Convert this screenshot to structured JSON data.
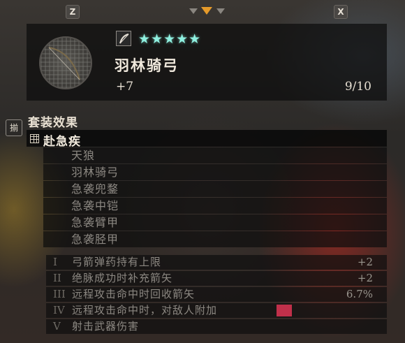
{
  "hotkeys": {
    "left": "Z",
    "right": "X"
  },
  "item": {
    "stars": "★★★★★",
    "name": "羽林骑弓",
    "enhance": "+7",
    "durability": "9/10",
    "icon": "bow-icon"
  },
  "side_tab": {
    "label": "揃"
  },
  "set": {
    "title": "套装效果",
    "name": "赴急疾",
    "pieces": [
      "天狼",
      "羽林骑弓",
      "急袭兜鍪",
      "急袭中铠",
      "急袭臂甲",
      "急袭胫甲"
    ],
    "bonuses": [
      {
        "num": "I",
        "text": "弓箭弹药持有上限",
        "value": "+2"
      },
      {
        "num": "II",
        "text": "绝脉成功时补充箭矢",
        "value": "+2"
      },
      {
        "num": "III",
        "text": "远程攻击命中时回收箭矢",
        "value": "6.7%"
      },
      {
        "num": "IV",
        "text": "远程攻击命中时，对敌人附加",
        "value": ""
      },
      {
        "num": "V",
        "text": "射击武器伤害",
        "value": ""
      }
    ]
  },
  "colors": {
    "stars": "#8ff0e0",
    "selector": "#e59a2a"
  }
}
